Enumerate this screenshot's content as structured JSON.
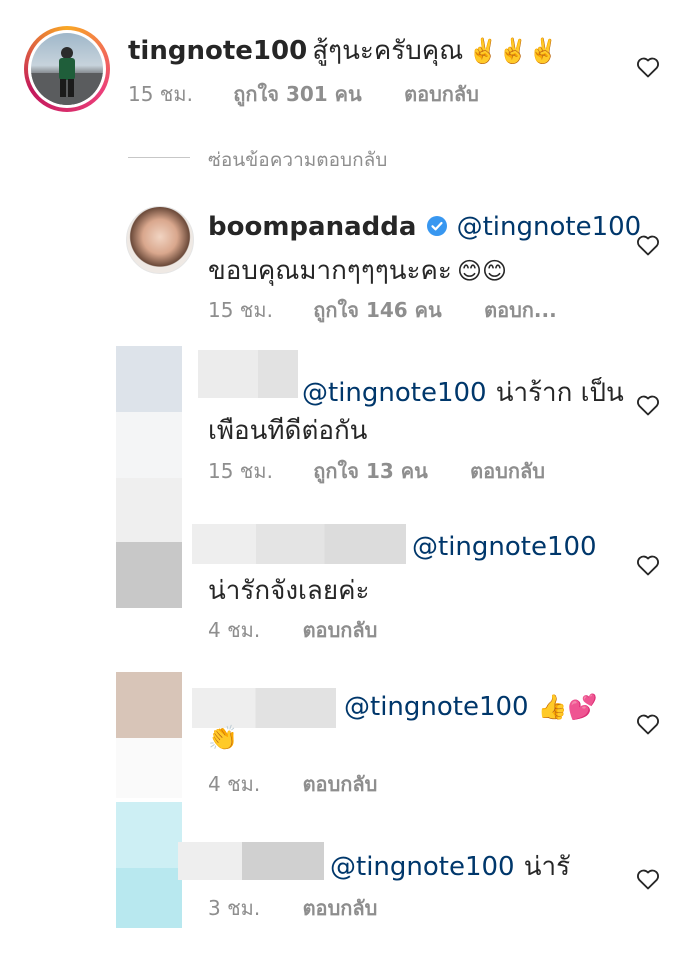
{
  "comments": [
    {
      "username": "tingnote100",
      "text": "สู้ๆนะครับคุณ",
      "emoji": "✌️✌️✌️",
      "time": "15 ชม.",
      "likes": "ถูกใจ 301 คน",
      "reply": "ตอบกลับ"
    },
    {
      "username": "boompanadda",
      "mention": "@tingnote100",
      "text": "ขอบคุณมากๆๆๆนะคะ",
      "emoji": "😊😊",
      "time": "15 ชม.",
      "likes": "ถูกใจ 146 คน",
      "reply": "ตอบก..."
    },
    {
      "mention": "@tingnote100",
      "text_line1": "น่าร้าก เป็น",
      "text_line2": "เพือนทีดีต่อกัน",
      "time": "15 ชม.",
      "likes": "ถูกใจ 13 คน",
      "reply": "ตอบกลับ"
    },
    {
      "mention": "@tingnote100",
      "text": "น่ารักจังเลยค่ะ",
      "time": "4 ชม.",
      "reply": "ตอบกลับ"
    },
    {
      "mention": "@tingnote100",
      "emoji_line1": "👍💕",
      "emoji_line2": "👏",
      "time": "4 ชม.",
      "reply": "ตอบกลับ"
    },
    {
      "mention": "@tingnote100",
      "text": "น่ารั",
      "time": "3 ชม.",
      "reply": "ตอบกลับ"
    }
  ],
  "hide_replies": "ซ่อนข้อความตอบกลับ",
  "colors": {
    "mention": "#00376b",
    "meta": "#8e8e8e",
    "verified": "#3897f0"
  }
}
